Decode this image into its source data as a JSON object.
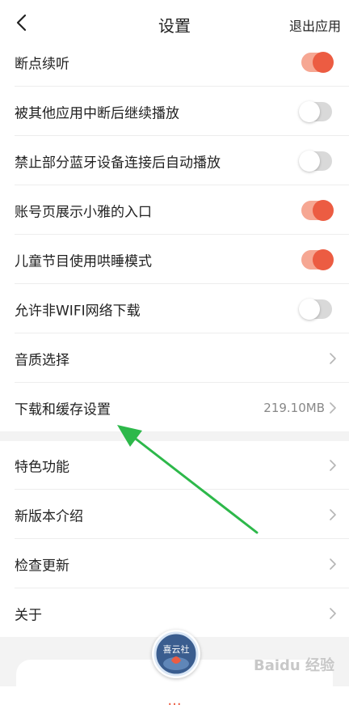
{
  "header": {
    "title": "设置",
    "exit_label": "退出应用",
    "back_icon": "chevron-left-icon"
  },
  "toggles": [
    {
      "label": "断点续听",
      "on": true
    },
    {
      "label": "被其他应用中断后继续播放",
      "on": false
    },
    {
      "label": "禁止部分蓝牙设备连接后自动播放",
      "on": false
    },
    {
      "label": "账号页展示小雅的入口",
      "on": true
    },
    {
      "label": "儿童节目使用哄睡模式",
      "on": true
    },
    {
      "label": "允许非WIFI网络下载",
      "on": false
    }
  ],
  "links_group1": [
    {
      "label": "音质选择",
      "value": ""
    },
    {
      "label": "下载和缓存设置",
      "value": "219.10MB"
    }
  ],
  "links_group2": [
    {
      "label": "特色功能"
    },
    {
      "label": "新版本介绍"
    },
    {
      "label": "检查更新"
    },
    {
      "label": "关于"
    }
  ],
  "footer": {
    "avatar_text": "喜云社",
    "button_text": "..."
  },
  "watermark": "Baidu 经验",
  "colors": {
    "accent": "#ec5c42",
    "accent_light": "#f6a793",
    "toggle_off": "#d9d9d9",
    "arrow": "#2db84a",
    "separator": "#f3f3f3"
  }
}
